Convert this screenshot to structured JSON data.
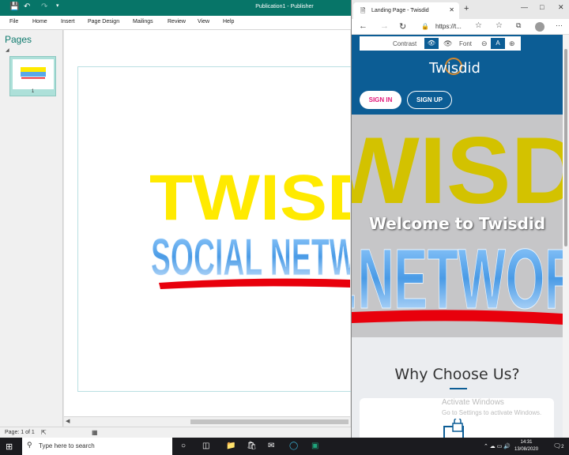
{
  "publisher": {
    "title": "Publication1 - Publisher",
    "tabs": [
      "File",
      "Home",
      "Insert",
      "Page Design",
      "Mailings",
      "Review",
      "View",
      "Help"
    ],
    "pages_pane": {
      "title": "Pages",
      "thumb_number": "1"
    },
    "status": {
      "page": "Page: 1 of 1"
    },
    "artwork": {
      "line1": "TWISD",
      "line2": "SOCIAL NETWO"
    }
  },
  "browser": {
    "tab_title": "Landing Page - Twisdid",
    "url": "https://t...",
    "accessibility": {
      "contrast": "Contrast",
      "font": "Font",
      "font_sample": "A"
    },
    "logo": "Twisdid",
    "signin": "SIGN IN",
    "signup": "SIGN UP",
    "hero_title": "Welcome to Twisdid",
    "hero_art": {
      "line1": "WISD",
      "line2": ".NETWOR"
    },
    "why_title": "Why Choose Us?",
    "watermark": {
      "line1": "Activate Windows",
      "line2": "Go to Settings to activate Windows."
    }
  },
  "taskbar": {
    "search_placeholder": "Type here to search",
    "time": "14:31",
    "date": "13/08/2020",
    "notifications": "2"
  },
  "colors": {
    "publisher_brand": "#077568",
    "site_blue": "#0c5d95",
    "art_yellow": "#ffea00",
    "art_blue": "#5aa8e8",
    "art_red": "#e8000c",
    "signin_pink": "#e2187a"
  }
}
